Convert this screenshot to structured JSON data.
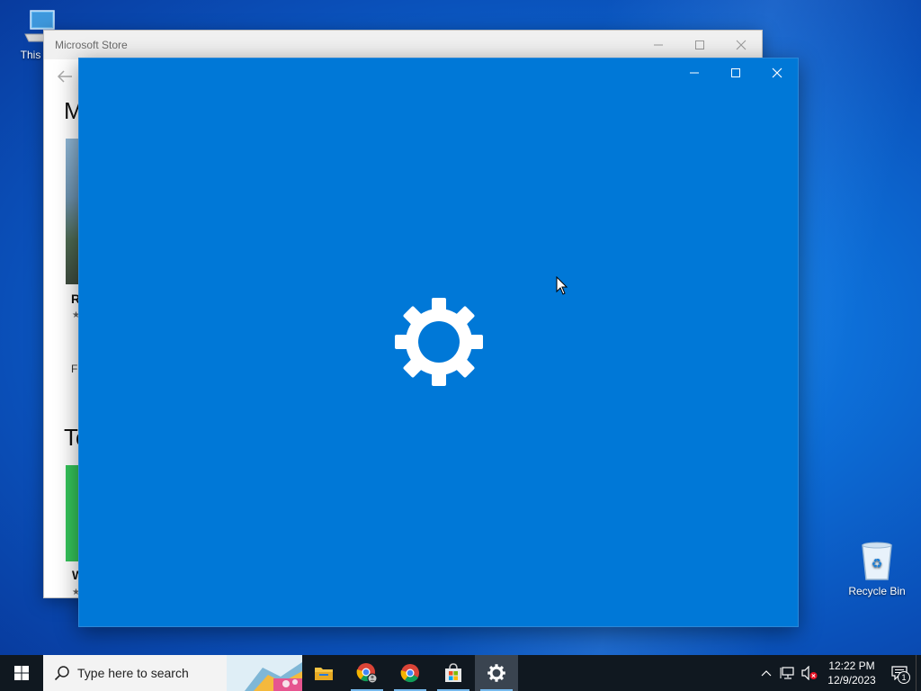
{
  "desktop": {
    "icons": [
      {
        "label": "This PC",
        "icon": "this-pc-icon"
      },
      {
        "label": "Recycle Bin",
        "icon": "recycle-bin-icon"
      }
    ]
  },
  "store_window": {
    "title": "Microsoft Store",
    "heading1": "M",
    "heading2": "To",
    "card1": {
      "title": "R",
      "rating": "★",
      "price": "Fr"
    },
    "card2": {
      "title": "W",
      "rating": "★"
    }
  },
  "settings_window": {
    "splash_icon": "gear-icon",
    "background": "#0078d7"
  },
  "taskbar": {
    "search_placeholder": "Type here to search",
    "apps": [
      {
        "name": "File Explorer",
        "icon": "folder-icon"
      },
      {
        "name": "Chrome Profile",
        "icon": "chrome-profile-icon"
      },
      {
        "name": "Google Chrome",
        "icon": "chrome-icon"
      },
      {
        "name": "Microsoft Store",
        "icon": "store-icon"
      },
      {
        "name": "Settings",
        "icon": "gear-icon"
      }
    ],
    "clock_time": "12:22 PM",
    "clock_date": "12/9/2023",
    "notification_count": "1"
  }
}
